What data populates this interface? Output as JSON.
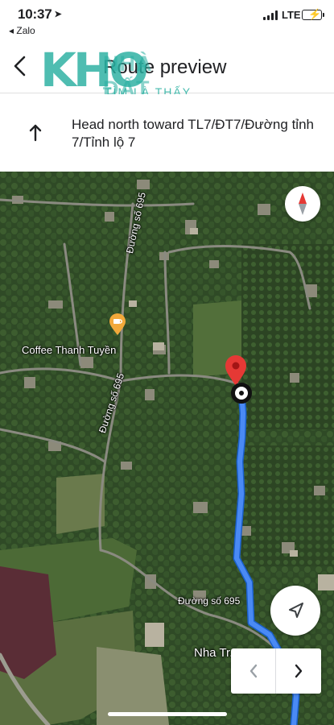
{
  "status_bar": {
    "time": "10:37",
    "back_app": "Zalo",
    "network": "LTE"
  },
  "header": {
    "title": "Route preview"
  },
  "watermark": {
    "brand_main": "KHO",
    "brand_secondary": "NHÀ ĐẤT",
    "tagline": "TÌM LÀ THẤY"
  },
  "step": {
    "instruction": "Head north toward TL7/ĐT7/Đường tỉnh 7/Tỉnh lộ 7",
    "icon": "straight-arrow-icon"
  },
  "map": {
    "places": {
      "cafe": "Coffee Thanh Tuyền",
      "road_a": "Đường số 695",
      "road_b": "Đường số 695",
      "road_c": "Đường số 695",
      "area": "Nha Tr..."
    },
    "colors": {
      "route": "#4a8af4",
      "destination_pin": "#e53935",
      "cafe_pin": "#f2a93b"
    }
  }
}
